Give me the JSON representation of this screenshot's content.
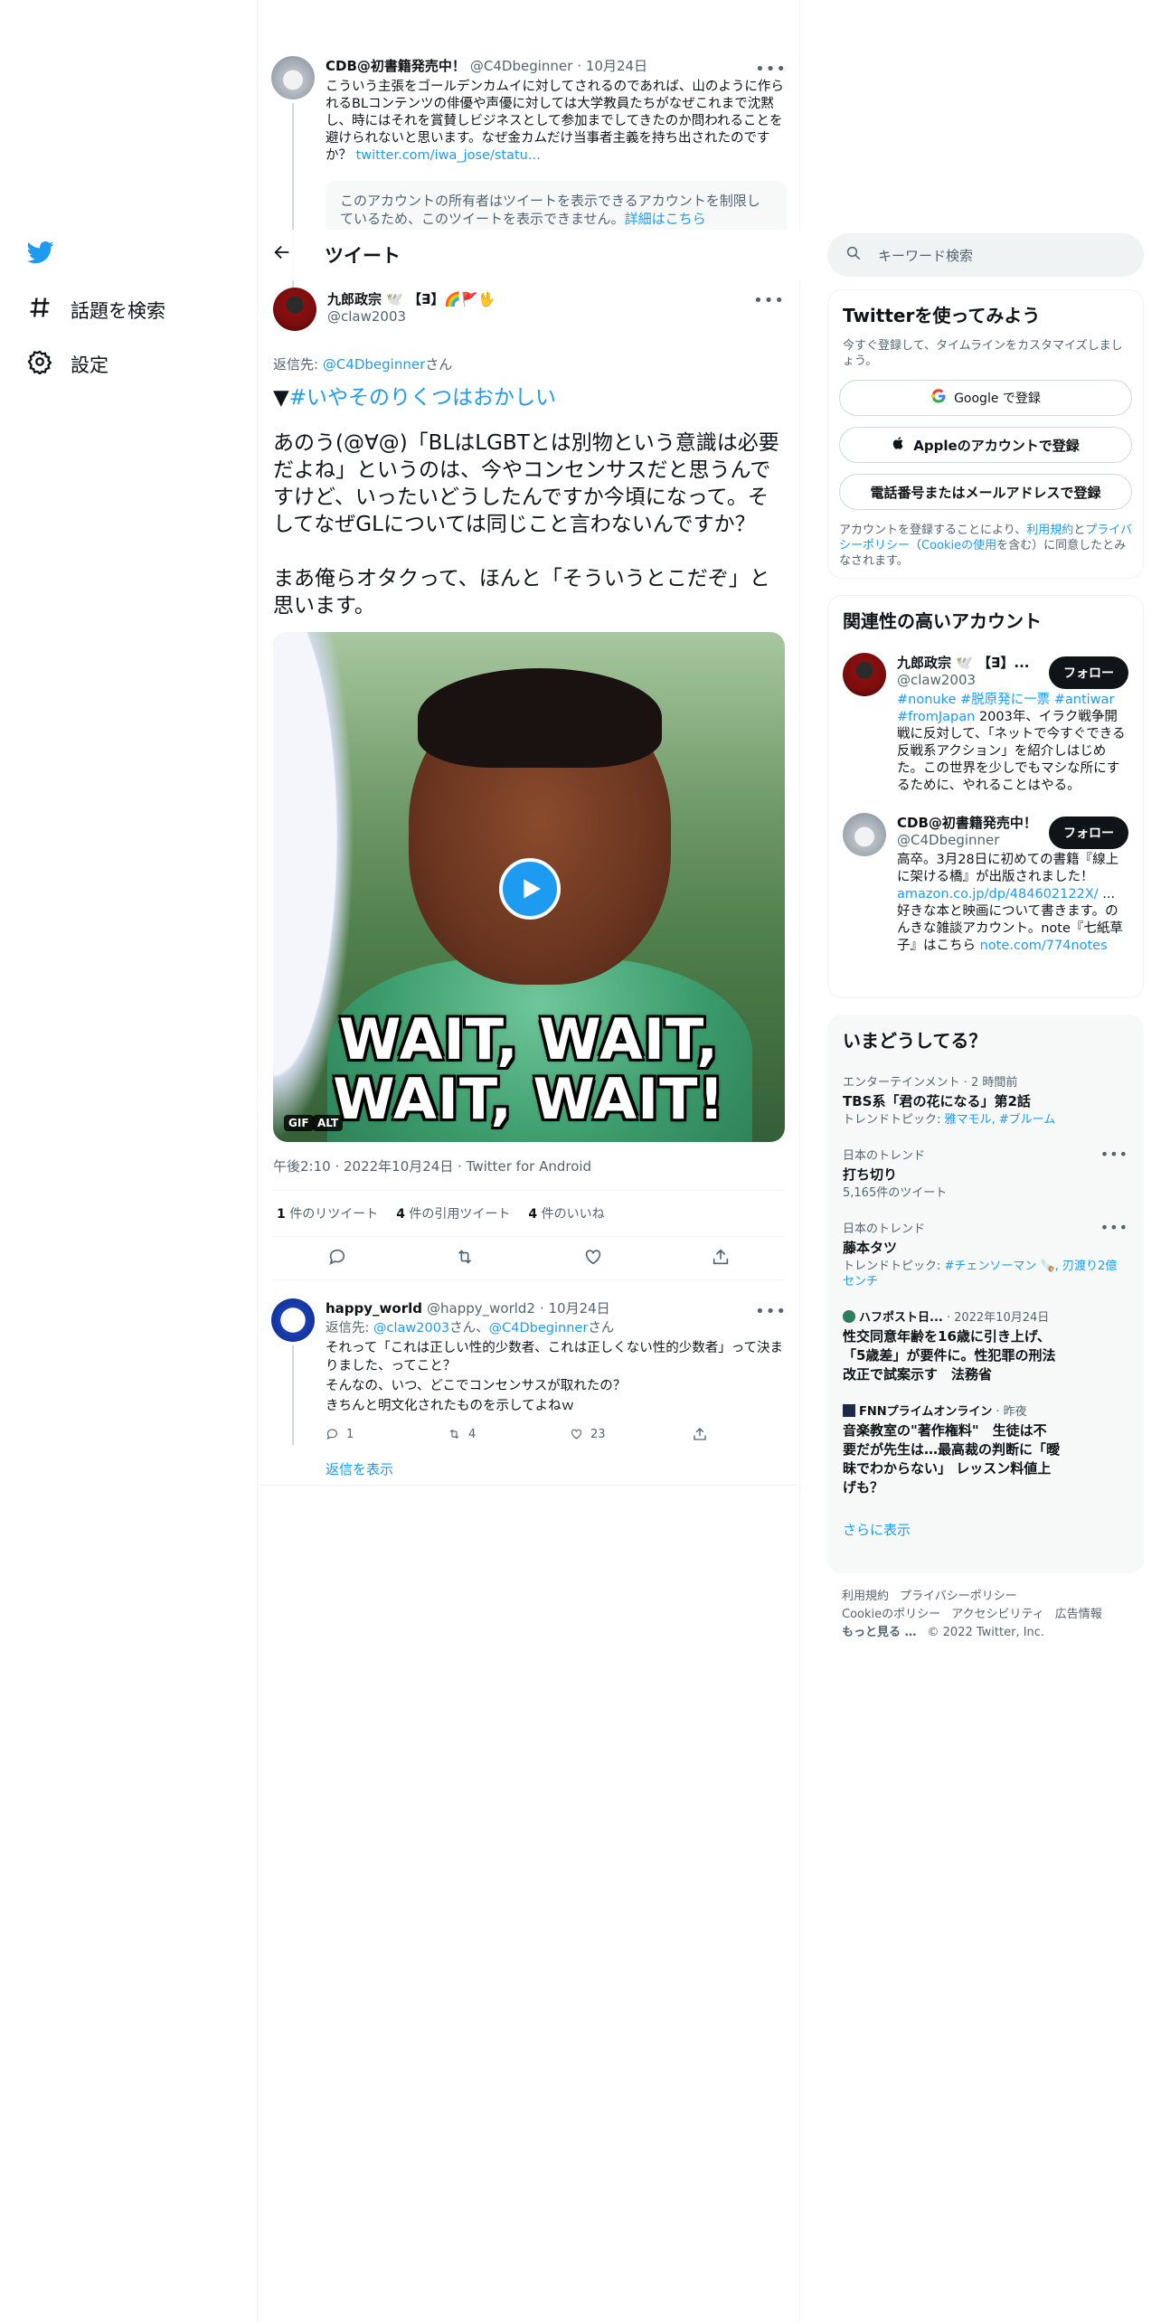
{
  "nav": {
    "explore_label": "話題を検索",
    "settings_label": "設定"
  },
  "header": {
    "title": "ツイート"
  },
  "parent_tweet": {
    "name": "CDB@初書籍発売中！",
    "handle": "@C4Dbeginner",
    "date": "· 10月24日",
    "text": "こういう主張をゴールデンカムイに対してされるのであれば、山のように作られるBLコンテンツの俳優や声優に対しては大学教員たちがなぜこれまで沈黙し、時にはそれを賞賛しビジネスとして参加までしてきたのか問われることを避けられないと思います。なぜ金カムだけ当事者主義を持ち出されたのですか？",
    "link": "twitter.com/iwa_jose/statu...",
    "restricted": "このアカウントの所有者はツイートを表示できるアカウントを制限しているため、このツイートを表示できません。",
    "restricted_link": "詳細はこちら"
  },
  "focal_tweet": {
    "name": "九郎政宗 🕊️ 【∃】🌈🚩🖖",
    "handle": "@claw2003",
    "reply_prefix": "返信先: ",
    "reply_to": "@C4Dbeginner",
    "reply_suffix": "さん",
    "hashtag_prefix": "▼",
    "hashtag": "#いやそのりくつはおかしい",
    "text": "あのう(@∀@)「BLはLGBTとは別物という意識は必要だよね」というのは、今やコンセンサスだと思うんですけど、いったいどうしたんですか今頃になって。そしてなぜGLについては同じこと言わないんですか？\n\nまあ俺らオタクって、ほんと「そういうとこだぞ」と思います。",
    "media_caption_1": "WAIT, WAIT,",
    "media_caption_2": "WAIT, WAIT!",
    "badge_gif": "GIF",
    "badge_alt": "ALT",
    "meta": "午後2:10 · 2022年10月24日 · Twitter for Android",
    "retweets": "1",
    "retweets_label": " 件のリツイート",
    "quotes": "4",
    "quotes_label": " 件の引用ツイート",
    "likes": "4",
    "likes_label": " 件のいいね"
  },
  "reply_tweet": {
    "name": "happy_world",
    "handle": "@happy_world2",
    "date": "· 10月24日",
    "reply_prefix": "返信先: ",
    "reply_to_1": "@claw2003",
    "reply_mid": "さん、",
    "reply_to_2": "@C4Dbeginner",
    "reply_suffix": "さん",
    "text_1": "それって「これは正しい性的少数者、これは正しくない性的少数者」って決まりました、ってこと？",
    "text_2": "そんなの、いつ、どこでコンセンサスが取れたの？",
    "text_3": "きちんと明文化されたものを示してよねｗ",
    "replies": "1",
    "retweets": "4",
    "likes": "23",
    "show_replies": "返信を表示"
  },
  "search": {
    "placeholder": "キーワード検索"
  },
  "signup": {
    "title": "Twitterを使ってみよう",
    "subtitle": "今すぐ登録して、タイムラインをカスタマイズしましょう。",
    "google": "Google で登録",
    "apple": "Appleのアカウントで登録",
    "phone": "電話番号またはメールアドレスで登録",
    "legal_1": "アカウントを登録することにより、",
    "legal_terms": "利用規約",
    "legal_2": "と",
    "legal_privacy": "プライバシーポリシー",
    "legal_3": "（",
    "legal_cookie": "Cookieの使用",
    "legal_4": "を含む）に同意したとみなされます。"
  },
  "related": {
    "title": "関連性の高いアカウント",
    "follow_label": "フォロー",
    "accounts": [
      {
        "name": "九郎政宗 🕊️ 【∃】...",
        "handle": "@claw2003",
        "bio_tags": "#nonuke #脱原発に一票 #antiwar #fromJapan",
        "bio": " 2003年、イラク戦争開戦に反対して、「ネットで今すぐできる反戦系アクション」を紹介しはじめた。この世界を少しでもマシな所にするために、やれることはやる。"
      },
      {
        "name": "CDB@初書籍発売中！",
        "handle": "@C4Dbeginner",
        "bio_1": "高卒。3月28日に初めての書籍『線上に架ける橋』が出版されました！",
        "bio_link": "amazon.co.jp/dp/484602122X/",
        "bio_2": " ... 好きな本と映画について書きます。のんきな雑談アカウント。note『七紙草子』はこちら ",
        "bio_link_2": "note.com/774notes"
      }
    ]
  },
  "trends": {
    "title": "いまどうしてる？",
    "items": [
      {
        "context": "エンターテインメント · 2 時間前",
        "title": "TBS系「君の花になる」第2話",
        "sub_prefix": "トレンドトピック: ",
        "sub_links": "雅マモル, #ブルーム"
      },
      {
        "context": "日本のトレンド",
        "title": "打ち切り",
        "sub": "5,165件のツイート"
      },
      {
        "context": "日本のトレンド",
        "title": "藤本タツ",
        "sub_prefix": "トレンドトピック: ",
        "sub_links": "#チェンソーマン 🪚, 刃渡り2億センチ"
      }
    ],
    "news": [
      {
        "source": "ハフポスト日...",
        "date": "· 2022年10月24日",
        "title": "性交同意年齢を16歳に引き上げ、「5歳差」が要件に。性犯罪の刑法改正で試案示す　法務省"
      },
      {
        "source": "FNNプライムオンライン",
        "date": "· 昨夜",
        "title": "音楽教室の\"著作権料\"　生徒は不要だが先生は…最高裁の判断に「曖昧でわからない」 レッスン料値上げも？"
      }
    ],
    "show_more": "さらに表示"
  },
  "footer": {
    "terms": "利用規約",
    "privacy": "プライバシーポリシー",
    "cookie": "Cookieのポリシー",
    "accessibility": "アクセシビリティ",
    "ads": "広告情報",
    "more": "もっと見る …",
    "copyright": "© 2022 Twitter, Inc."
  },
  "colors": {
    "accent": "#1d9bf0",
    "text": "#0f1419",
    "muted": "#536471",
    "border": "#eff3f4"
  }
}
